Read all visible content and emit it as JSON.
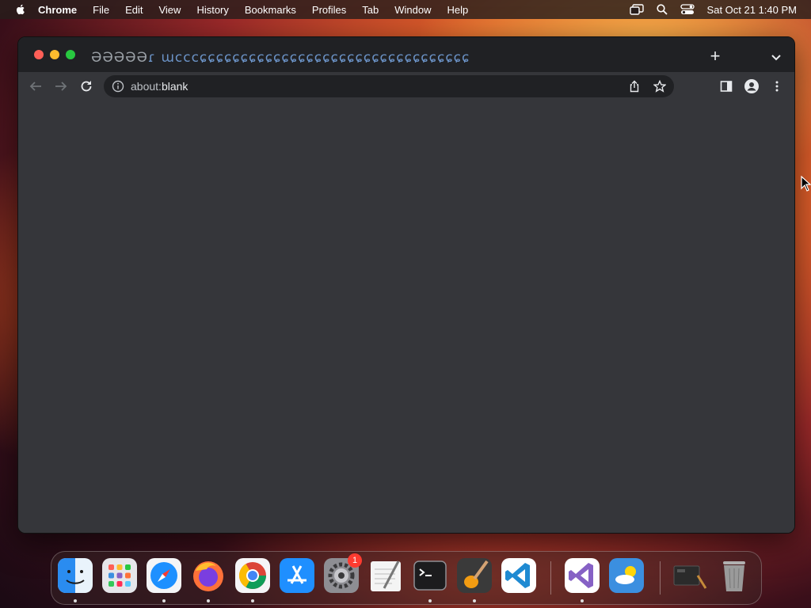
{
  "menubar": {
    "app_name": "Chrome",
    "items": [
      "File",
      "Edit",
      "View",
      "History",
      "Bookmarks",
      "Profiles",
      "Tab",
      "Window",
      "Help"
    ],
    "datetime": "Sat Oct 21  1:40 PM"
  },
  "browser": {
    "tab_glyphs_gray": "ƏƏƏƏƏ",
    "tab_glyphs_blue": "ɾ ɯcccɕɕɕɕɕɕɕɕɕɕɕɕɕɕɕɕɕɕɕɕɕɕɕɕɕɕɕɕɕɕɕɕɕ",
    "new_tab_label": "+",
    "address": {
      "scheme": "about:",
      "host": "blank"
    }
  },
  "dock": {
    "apps": [
      {
        "name": "Finder",
        "icon": "finder-icon",
        "running": true,
        "color": "#2a8cf0"
      },
      {
        "name": "Launchpad",
        "icon": "launchpad-icon",
        "running": false,
        "color": "#e6e6ea"
      },
      {
        "name": "Safari",
        "icon": "safari-icon",
        "running": true,
        "color": "#1e90ff"
      },
      {
        "name": "Firefox",
        "icon": "firefox-icon",
        "running": true,
        "color": "#ff7139"
      },
      {
        "name": "Chrome",
        "icon": "chrome-icon",
        "running": true,
        "color": "#fbbc04"
      },
      {
        "name": "App Store",
        "icon": "appstore-icon",
        "running": false,
        "color": "#1f8fff"
      },
      {
        "name": "System Settings",
        "icon": "settings-icon",
        "running": false,
        "color": "#8e8e93",
        "badge": "1"
      },
      {
        "name": "TextEdit",
        "icon": "textedit-icon",
        "running": false,
        "color": "#f4f4f4"
      },
      {
        "name": "Terminal",
        "icon": "terminal-icon",
        "running": true,
        "color": "#1c1c1e"
      },
      {
        "name": "GarageBand",
        "icon": "garageband-icon",
        "running": true,
        "color": "#3a3a3a"
      },
      {
        "name": "VS Code",
        "icon": "vscode-icon",
        "running": true,
        "color": "#1f8ad2"
      },
      {
        "name": "Visual Studio",
        "icon": "visualstudio-icon",
        "running": true,
        "color": "#8661c5"
      },
      {
        "name": "Weather",
        "icon": "weather-icon",
        "running": false,
        "color": "#3b8fe0"
      },
      {
        "name": "Screenshot",
        "icon": "screenshot-icon",
        "running": false,
        "color": "#2b2b2b"
      },
      {
        "name": "Trash",
        "icon": "trash-icon",
        "running": false,
        "color": "#9a9a9a"
      }
    ]
  }
}
